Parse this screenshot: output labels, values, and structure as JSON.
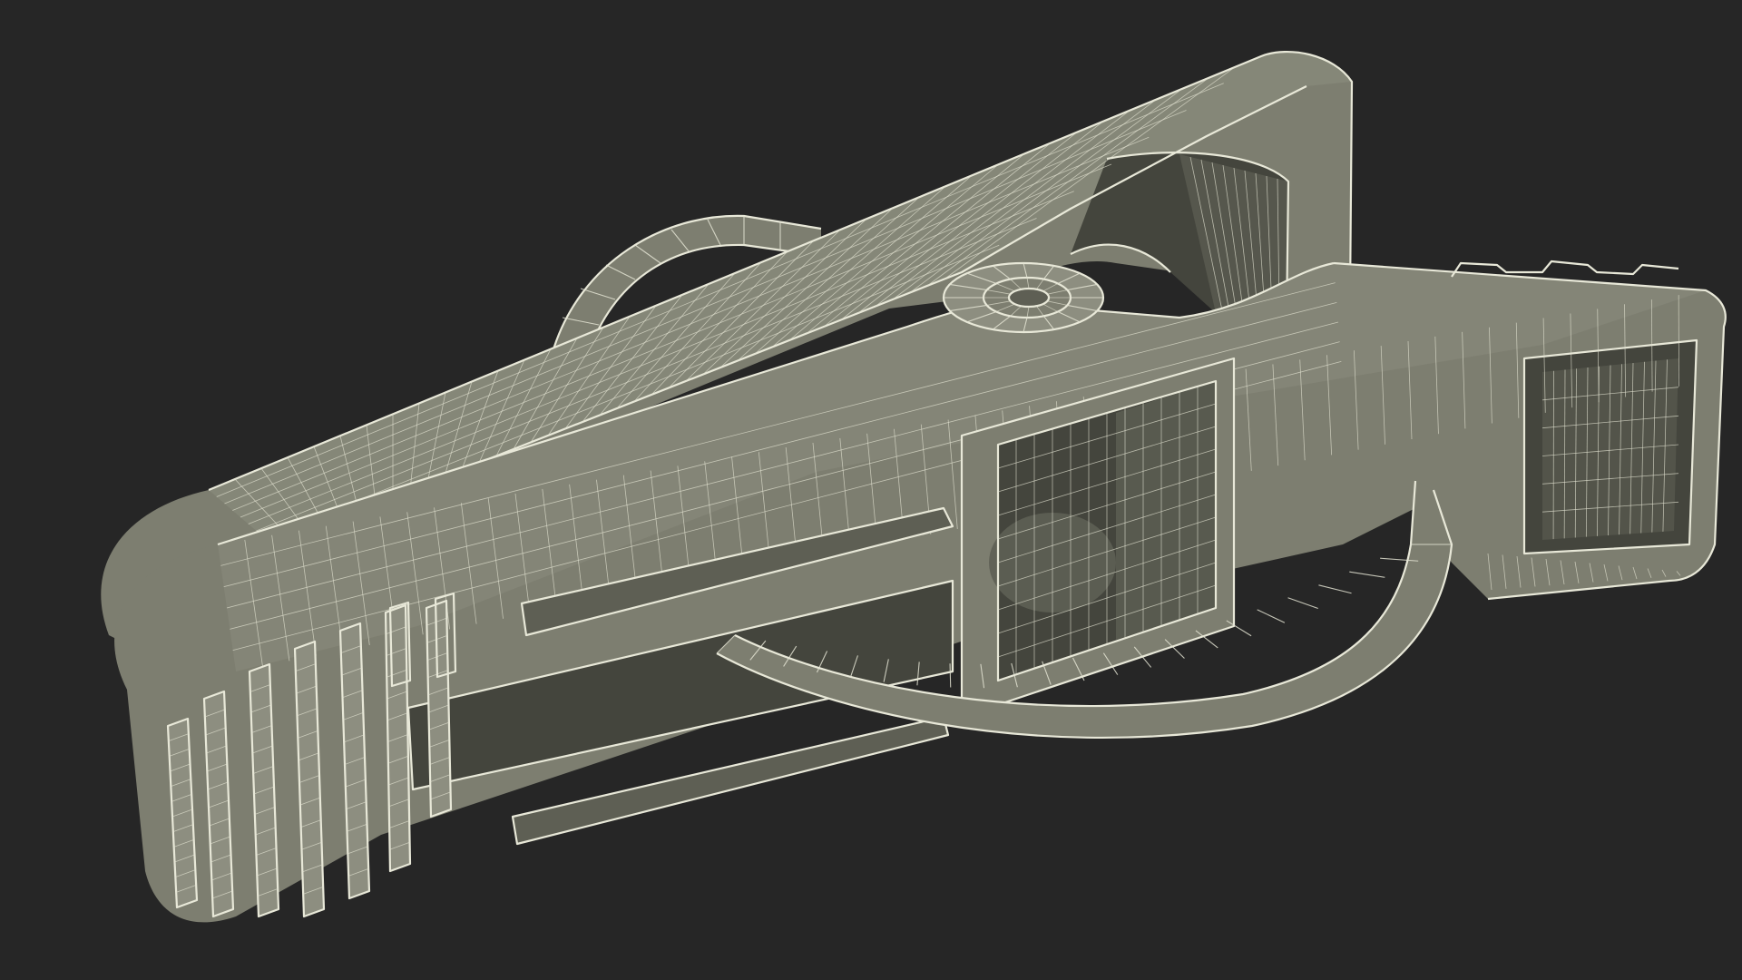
{
  "scene": {
    "subject": "wireframe-model-alligator-clip",
    "render_style": "wireframe-over-clay",
    "colors": {
      "background": "#262626",
      "clay": "#7d7e70",
      "clay_dark": "#5e5f54",
      "cavity": "#44453d",
      "wire": "#e8e8d8"
    }
  }
}
